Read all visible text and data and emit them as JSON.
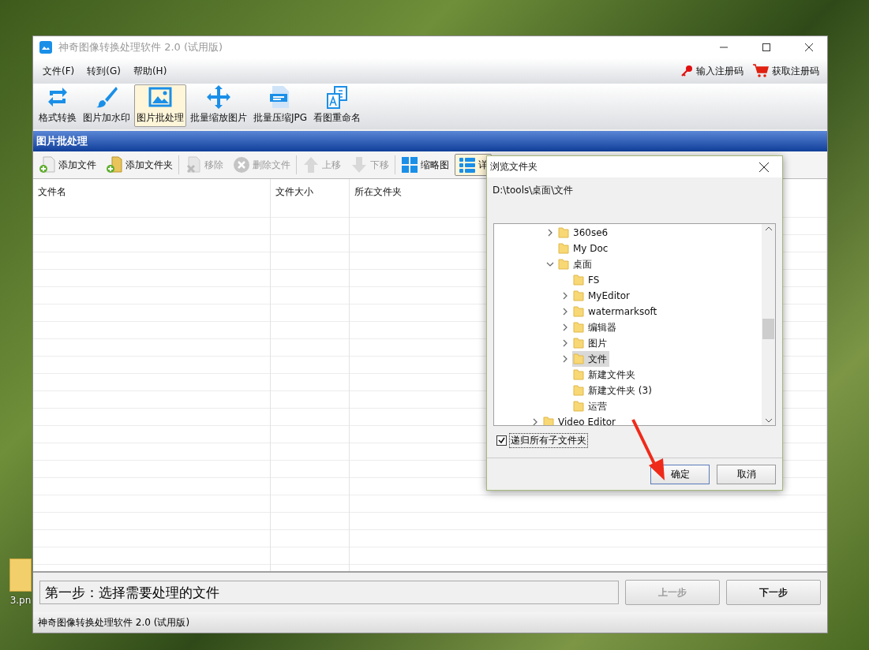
{
  "desktop": {
    "icon_label": "3.pn"
  },
  "window": {
    "title": "神奇图像转换处理软件 2.0 (试用版)"
  },
  "menu": [
    {
      "label": "文件(F)"
    },
    {
      "label": "转到(G)"
    },
    {
      "label": "帮助(H)"
    }
  ],
  "header_links": [
    {
      "label": "输入注册码"
    },
    {
      "label": "获取注册码"
    }
  ],
  "toolbar": [
    {
      "label": "格式转换",
      "selected": false
    },
    {
      "label": "图片加水印",
      "selected": false
    },
    {
      "label": "图片批处理",
      "selected": true
    },
    {
      "label": "批量缩放图片",
      "selected": false
    },
    {
      "label": "批量压缩JPG",
      "selected": false
    },
    {
      "label": "看图重命名",
      "selected": false
    }
  ],
  "section_title": "图片批处理",
  "actions": [
    {
      "label": "添加文件",
      "disabled": false,
      "selected": false
    },
    {
      "label": "添加文件夹",
      "disabled": false,
      "selected": false
    },
    {
      "label": "移除",
      "disabled": true,
      "selected": false
    },
    {
      "label": "删除文件",
      "disabled": true,
      "selected": false
    },
    {
      "label": "上移",
      "disabled": true,
      "selected": false
    },
    {
      "label": "下移",
      "disabled": true,
      "selected": false
    },
    {
      "label": "缩略图",
      "disabled": false,
      "selected": false
    },
    {
      "label": "详",
      "disabled": false,
      "selected": true
    }
  ],
  "table": {
    "columns": [
      "文件名",
      "文件大小",
      "所在文件夹"
    ]
  },
  "step_text": "第一步：选择需要处理的文件",
  "nav_buttons": [
    {
      "label": "上一步",
      "disabled": true
    },
    {
      "label": "下一步",
      "disabled": false
    }
  ],
  "status_bar": "神奇图像转换处理软件 2.0 (试用版)",
  "dialog": {
    "title": "浏览文件夹",
    "path": "D:\\tools\\桌面\\文件",
    "tree": {
      "nested_items": [
        {
          "label": "360se6",
          "expandable": true,
          "expanded": false,
          "selected": false
        },
        {
          "label": "My Doc",
          "expandable": false,
          "selected": false
        },
        {
          "label": "桌面",
          "expandable": true,
          "expanded": true,
          "selected": false,
          "children": [
            {
              "label": "FS",
              "expandable": false,
              "selected": false
            },
            {
              "label": "MyEditor",
              "expandable": true,
              "expanded": false,
              "selected": false
            },
            {
              "label": "watermarksoft",
              "expandable": true,
              "expanded": false,
              "selected": false
            },
            {
              "label": "编辑器",
              "expandable": true,
              "expanded": false,
              "selected": false
            },
            {
              "label": "图片",
              "expandable": true,
              "expanded": false,
              "selected": false
            },
            {
              "label": "文件",
              "expandable": true,
              "expanded": false,
              "selected": true
            },
            {
              "label": "新建文件夹",
              "expandable": false,
              "selected": false
            },
            {
              "label": "新建文件夹 (3)",
              "expandable": false,
              "selected": false
            },
            {
              "label": "运营",
              "expandable": false,
              "selected": false
            }
          ]
        }
      ],
      "outer_items": [
        {
          "label": "Video Editor",
          "expandable": true,
          "expanded": false,
          "selected": false
        }
      ]
    },
    "checkbox": {
      "label": "递归所有子文件夹",
      "checked": true
    },
    "buttons": [
      {
        "label": "确定",
        "default": true
      },
      {
        "label": "取消",
        "default": false
      }
    ]
  }
}
